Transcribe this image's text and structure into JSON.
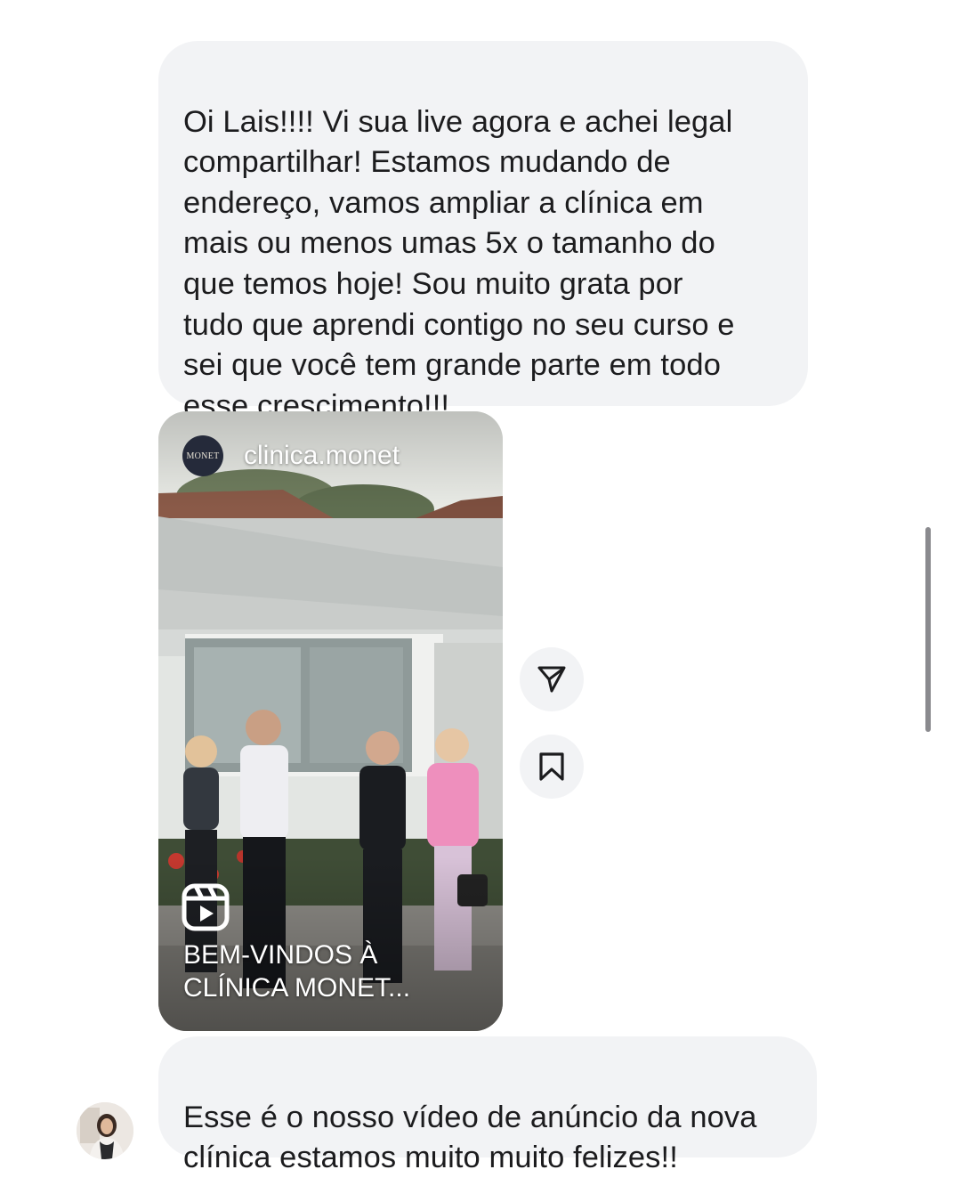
{
  "messages": [
    {
      "id": "msg1",
      "text": "Oi Lais!!!! Vi sua live agora e achei legal\ncompartilhar! Estamos mudando de\nendereço, vamos ampliar a clínica em\nmais ou menos umas 5x o tamanho do\nque temos hoje! Sou muito grata por\ntudo que aprendi contigo no seu curso e\nsei que você tem grande parte em todo\nesse crescimento!!!"
    },
    {
      "id": "msg2",
      "text": "Esse é o nosso vídeo de anúncio da nova\nclínica estamos muito muito felizes!!"
    }
  ],
  "shared_reel": {
    "username": "clinica.monet",
    "avatar_text": "MONET",
    "caption": "BEM-VINDOS À\nCLÍNICA MONET...",
    "type_icon": "reels-icon"
  },
  "actions": {
    "share_icon": "send-icon",
    "save_icon": "bookmark-icon"
  },
  "colors": {
    "bubble_bg": "#f2f3f5",
    "text": "#1c1c1e",
    "avatar_bg": "#252a3a"
  }
}
